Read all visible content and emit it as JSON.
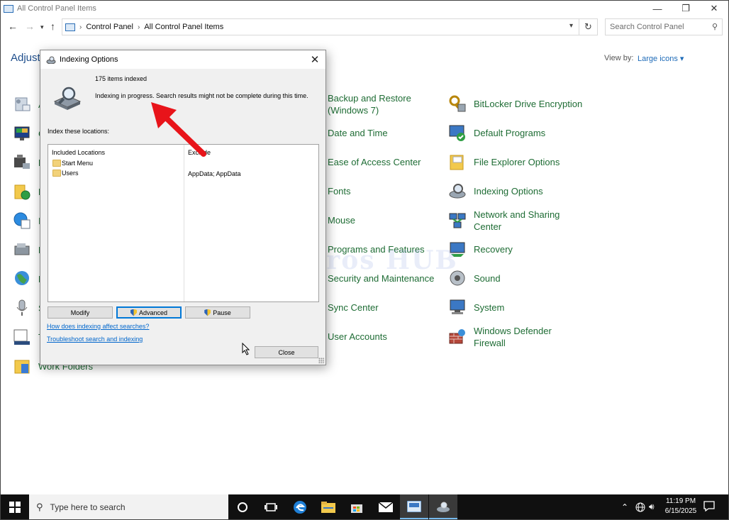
{
  "window": {
    "title": "All Control Panel Items",
    "controls": {
      "minimize": "—",
      "restore": "❐",
      "close": "✕"
    }
  },
  "address": {
    "crumbs": [
      "Control Panel",
      "All Control Panel Items"
    ],
    "search_placeholder": "Search Control Panel"
  },
  "header": {
    "adjust_text": "Adjust y",
    "view_by_label": "View by:",
    "view_by_value": "Large icons ▾"
  },
  "items": {
    "col1": [
      {
        "label": "A",
        "icon": "admin-tools-icon"
      },
      {
        "label": "C",
        "icon": "color-management-icon"
      },
      {
        "label": "D",
        "icon": "device-manager-icon"
      },
      {
        "label": "F",
        "icon": "file-history-icon"
      },
      {
        "label": "I",
        "icon": "internet-options-icon"
      },
      {
        "label": "P",
        "icon": "phone-modem-icon"
      },
      {
        "label": "R",
        "icon": "region-icon"
      },
      {
        "label": "S",
        "icon": "speech-recognition-icon"
      },
      {
        "label": "T",
        "icon": "taskbar-navigation-icon"
      },
      {
        "label": "Work Folders",
        "icon": "work-folders-icon"
      }
    ],
    "col2": [
      {
        "label": "Backup and Restore\n(Windows 7)",
        "icon": "backup-icon"
      },
      {
        "label": "Date and Time",
        "icon": "clock-icon"
      },
      {
        "label": "Ease of Access Center",
        "icon": "ease-of-access-icon"
      },
      {
        "label": "Fonts",
        "icon": "fonts-icon"
      },
      {
        "label": "Mouse",
        "icon": "mouse-icon"
      },
      {
        "label": "Programs and Features",
        "icon": "programs-icon"
      },
      {
        "label": "Security and Maintenance",
        "icon": "flag-icon"
      },
      {
        "label": "Sync Center",
        "icon": "sync-icon"
      },
      {
        "label": "User Accounts",
        "icon": "user-icon"
      }
    ],
    "col3": [
      {
        "label": "BitLocker Drive Encryption",
        "icon": "bitlocker-icon"
      },
      {
        "label": "Default Programs",
        "icon": "default-programs-icon"
      },
      {
        "label": "File Explorer Options",
        "icon": "folder-options-icon"
      },
      {
        "label": "Indexing Options",
        "icon": "indexing-icon"
      },
      {
        "label": "Network and Sharing\nCenter",
        "icon": "network-icon"
      },
      {
        "label": "Recovery",
        "icon": "recovery-icon"
      },
      {
        "label": "Sound",
        "icon": "speaker-icon"
      },
      {
        "label": "System",
        "icon": "system-icon"
      },
      {
        "label": "Windows Defender\nFirewall",
        "icon": "firewall-icon"
      }
    ]
  },
  "watermark": "IT Pros HUB",
  "dialog": {
    "title": "Indexing Options",
    "items_indexed": "175 items indexed",
    "status": "Indexing in progress. Search results might not be complete during this time.",
    "locations_label": "Index these locations:",
    "columns": {
      "included": "Included Locations",
      "exclude": "Exclude"
    },
    "locations": [
      {
        "name": "Start Menu",
        "exclude": ""
      },
      {
        "name": "Users",
        "exclude": "AppData; AppData"
      }
    ],
    "buttons": {
      "modify": "Modify",
      "advanced": "Advanced",
      "pause": "Pause",
      "close": "Close"
    },
    "links": {
      "how_affect": "How does indexing affect searches?",
      "troubleshoot": "Troubleshoot search and indexing"
    },
    "close_glyph": "✕"
  },
  "taskbar": {
    "search_placeholder": "Type here to search",
    "time": "11:19 PM",
    "date": "6/15/2025"
  },
  "colors": {
    "link_green": "#1e6c34",
    "accent_blue": "#0078d7",
    "arrow_red": "#e8141a"
  }
}
